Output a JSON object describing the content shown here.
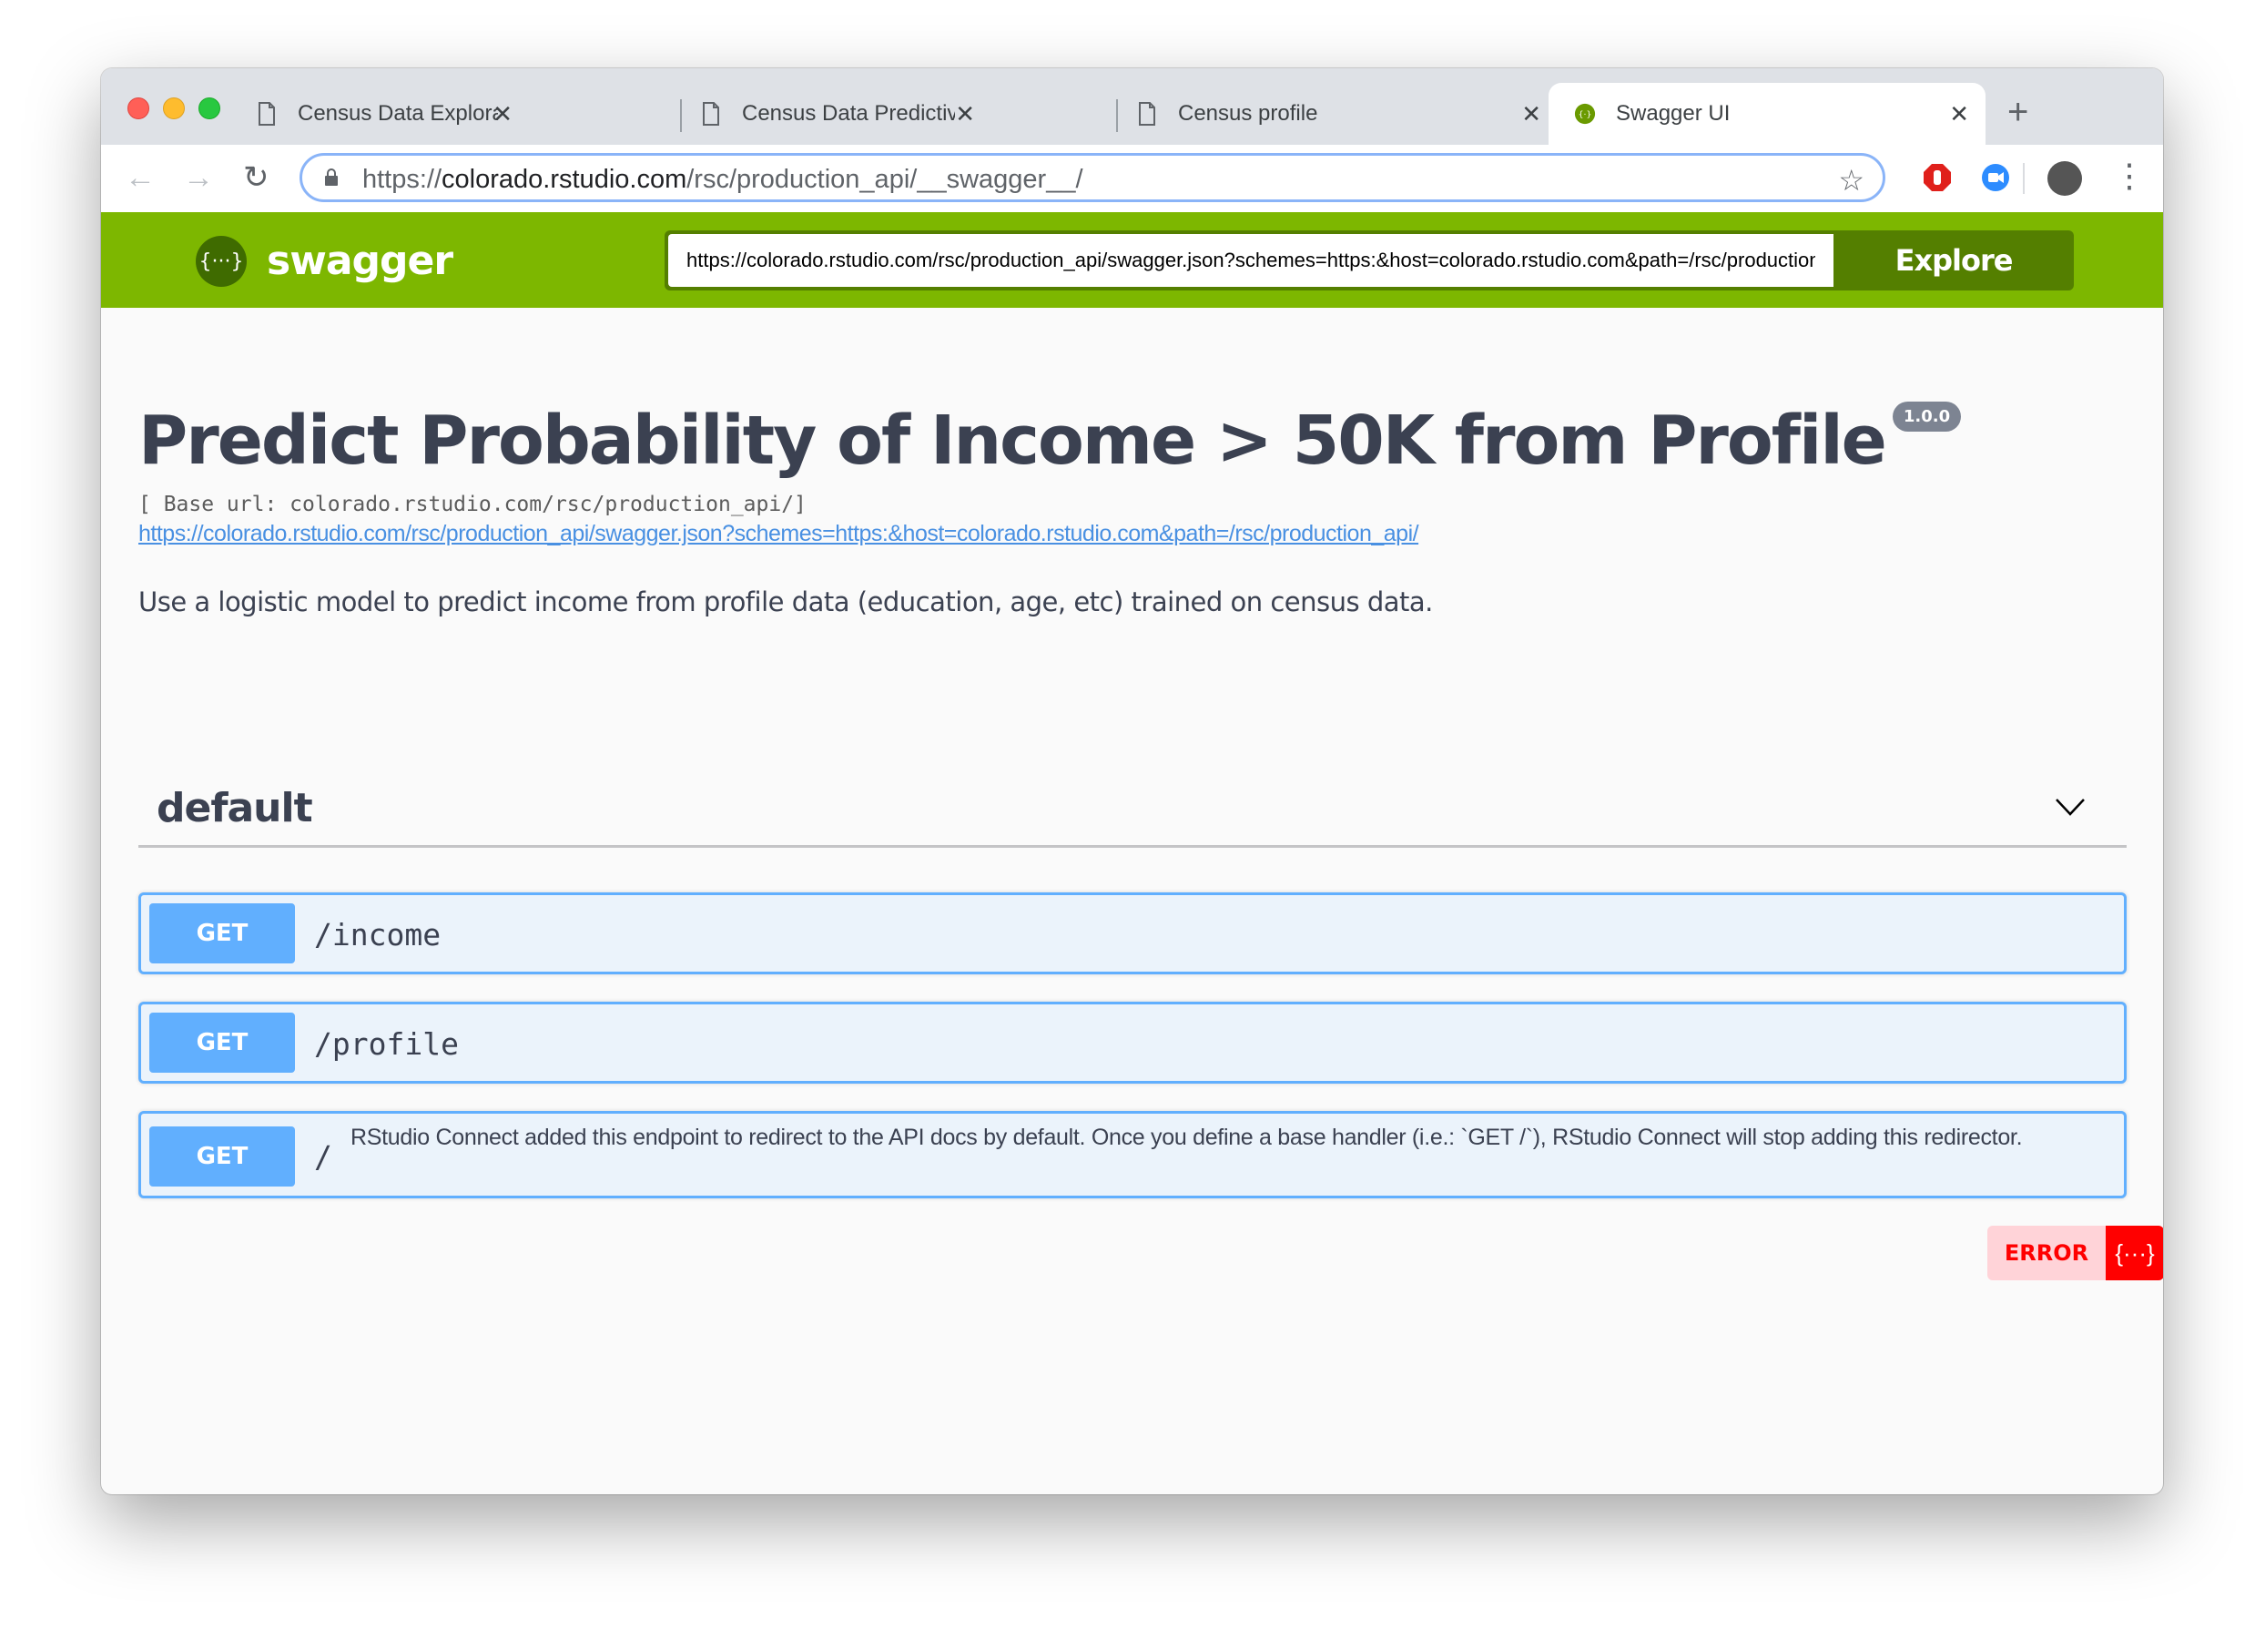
{
  "browser": {
    "tabs": [
      {
        "title": "Census Data Exploratory Analy",
        "icon": "document-icon",
        "active": false
      },
      {
        "title": "Census Data Predictive Models",
        "icon": "document-icon",
        "active": false
      },
      {
        "title": "Census profile",
        "icon": "document-icon",
        "active": false
      },
      {
        "title": "Swagger UI",
        "icon": "swagger-favicon-icon",
        "active": true
      }
    ],
    "close_glyph": "✕",
    "new_tab_glyph": "+",
    "url": {
      "scheme": "https://",
      "host": "colorado.rstudio.com",
      "path": "/rsc/production_api/__swagger__/"
    },
    "nav": {
      "back": "←",
      "forward": "→",
      "reload": "↻",
      "star": "☆",
      "menu": "⋮"
    },
    "extensions": [
      {
        "name": "adblock-icon",
        "color": "#e0201b"
      },
      {
        "name": "zoom-icon",
        "color": "#2d8cff"
      }
    ]
  },
  "swagger_header": {
    "logo_glyph": "{···}",
    "brand": "swagger",
    "spec_url_value": "https://colorado.rstudio.com/rsc/production_api/swagger.json?schemes=https:&host=colorado.rstudio.com&path=/rsc/production_api/",
    "explore_label": "Explore",
    "color": "#7db700"
  },
  "info": {
    "title": "Predict Probability of Income > 50K from Profile",
    "version": "1.0.0",
    "base_url": "[ Base url: colorado.rstudio.com/rsc/production_api/]",
    "spec_link": "https://colorado.rstudio.com/rsc/production_api/swagger.json?schemes=https:&host=colorado.rstudio.com&path=/rsc/production_api/",
    "description": "Use a logistic model to predict income from profile data (education, age, etc) trained on census data."
  },
  "tag": {
    "name": "default",
    "operations": [
      {
        "method": "GET",
        "path": "/income",
        "summary": ""
      },
      {
        "method": "GET",
        "path": "/profile",
        "summary": ""
      },
      {
        "method": "GET",
        "path": "/",
        "summary": "RStudio Connect added this endpoint to redirect to the API docs by default. Once you define a base handler (i.e.: `GET /`), RStudio Connect will stop adding this redirector."
      }
    ]
  },
  "validator": {
    "label": "ERROR",
    "icon_glyph": "{···}"
  }
}
